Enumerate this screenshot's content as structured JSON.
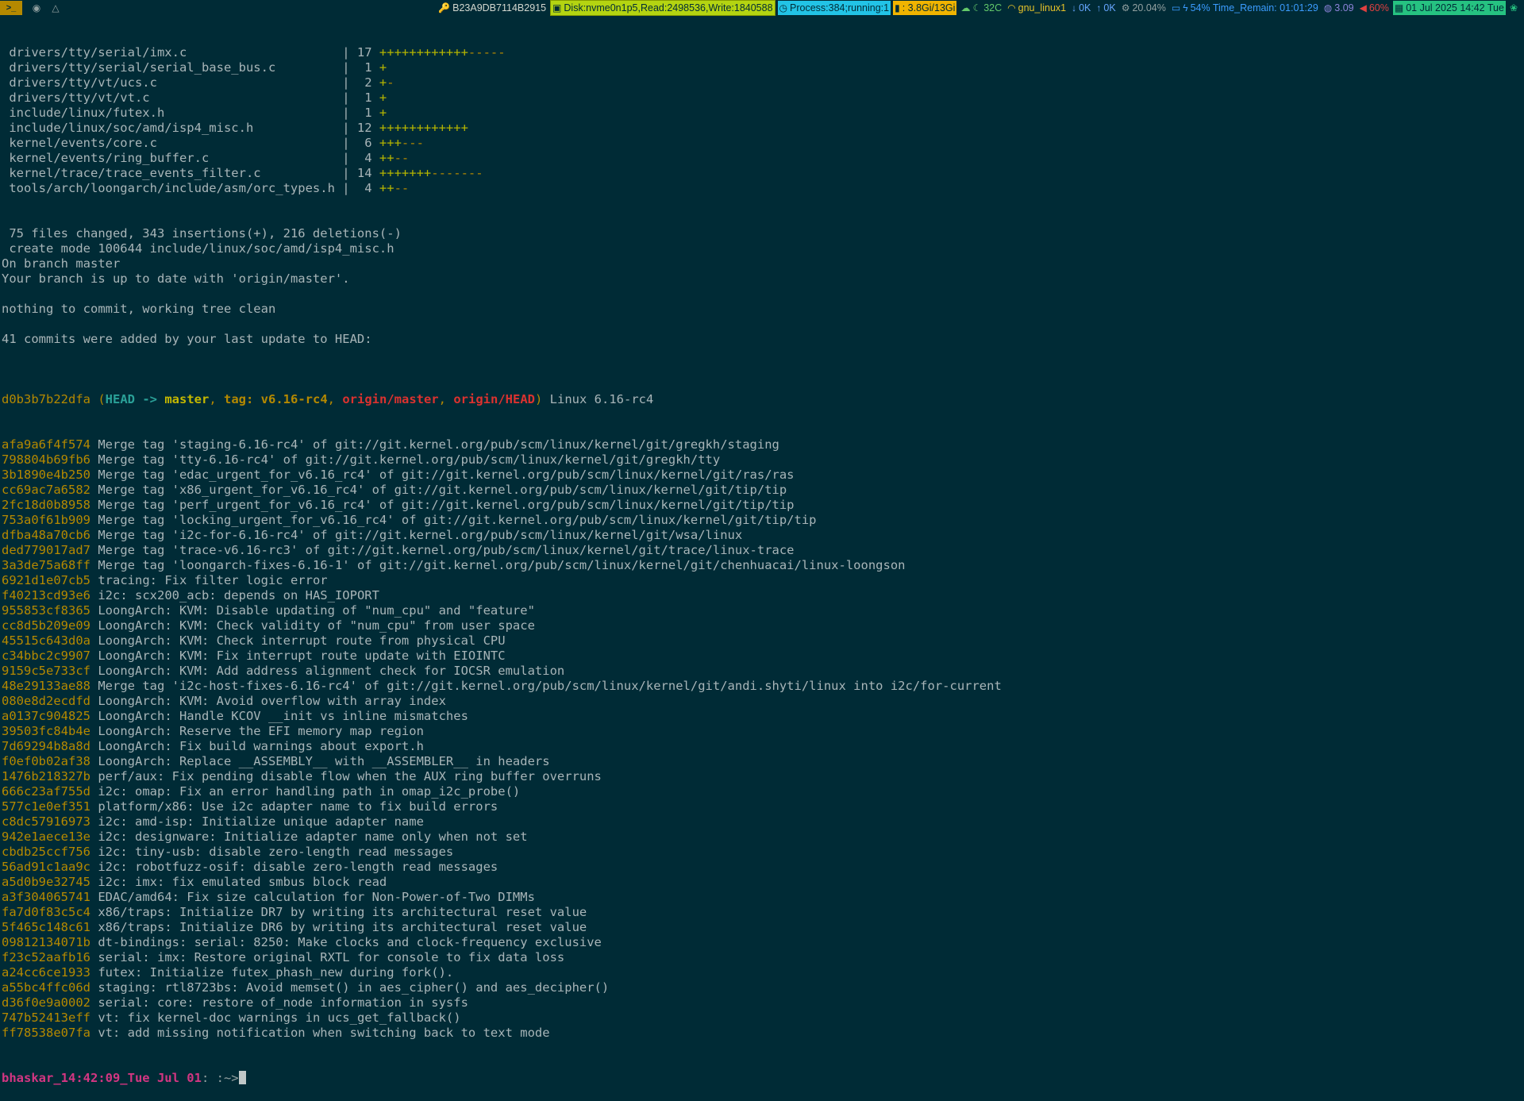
{
  "statusbar": {
    "launcher": {
      "terminal": ">_",
      "btn2": "◉",
      "btn3": "△"
    },
    "key": "B23A9DB7114B2915",
    "disk": "Disk:nvme0n1p5,Read:2498536,Write:1840588",
    "process": "Process:384;running:1",
    "memory": ": 3.8Gi/13Gi",
    "temp": "32C",
    "network": "gnu_linux1",
    "download": "0K",
    "upload": "0K",
    "cpu": "20.04%",
    "battery": "54% Time_Remain: 01:01:29",
    "load": "3.09",
    "volume": "60%",
    "datetime": "01 Jul 2025 14:42 Tue"
  },
  "diffstat": [
    {
      "file": "drivers/tty/serial/imx.c",
      "count": "17",
      "plus": "++++++++++++",
      "minus": "-----"
    },
    {
      "file": "drivers/tty/serial/serial_base_bus.c",
      "count": "1",
      "plus": "+",
      "minus": ""
    },
    {
      "file": "drivers/tty/vt/ucs.c",
      "count": "2",
      "plus": "+",
      "minus": "-"
    },
    {
      "file": "drivers/tty/vt/vt.c",
      "count": "1",
      "plus": "+",
      "minus": ""
    },
    {
      "file": "include/linux/futex.h",
      "count": "1",
      "plus": "+",
      "minus": ""
    },
    {
      "file": "include/linux/soc/amd/isp4_misc.h",
      "count": "12",
      "plus": "++++++++++++",
      "minus": ""
    },
    {
      "file": "kernel/events/core.c",
      "count": "6",
      "plus": "+++",
      "minus": "---"
    },
    {
      "file": "kernel/events/ring_buffer.c",
      "count": "4",
      "plus": "++",
      "minus": "--"
    },
    {
      "file": "kernel/trace/trace_events_filter.c",
      "count": "14",
      "plus": "+++++++",
      "minus": "-------"
    },
    {
      "file": "tools/arch/loongarch/include/asm/orc_types.h",
      "count": "4",
      "plus": "++",
      "minus": "--"
    }
  ],
  "summary": [
    " 75 files changed, 343 insertions(+), 216 deletions(-)",
    " create mode 100644 include/linux/soc/amd/isp4_misc.h",
    "On branch master",
    "Your branch is up to date with 'origin/master'.",
    "",
    "nothing to commit, working tree clean",
    "",
    "41 commits were added by your last update to HEAD:",
    ""
  ],
  "head_commit": {
    "hash": "d0b3b7b22dfa",
    "head": "HEAD",
    "arrow": " -> ",
    "branch": "master",
    "tag": "tag: v6.16-rc4",
    "remote1": "origin/master",
    "remote2": "origin/HEAD",
    "message": "Linux 6.16-rc4"
  },
  "commits": [
    {
      "hash": "afa9a6f4f574",
      "message": "Merge tag 'staging-6.16-rc4' of git://git.kernel.org/pub/scm/linux/kernel/git/gregkh/staging"
    },
    {
      "hash": "798804b69fb6",
      "message": "Merge tag 'tty-6.16-rc4' of git://git.kernel.org/pub/scm/linux/kernel/git/gregkh/tty"
    },
    {
      "hash": "3b1890e4b250",
      "message": "Merge tag 'edac_urgent_for_v6.16_rc4' of git://git.kernel.org/pub/scm/linux/kernel/git/ras/ras"
    },
    {
      "hash": "cc69ac7a6582",
      "message": "Merge tag 'x86_urgent_for_v6.16_rc4' of git://git.kernel.org/pub/scm/linux/kernel/git/tip/tip"
    },
    {
      "hash": "2fc18d0b8958",
      "message": "Merge tag 'perf_urgent_for_v6.16_rc4' of git://git.kernel.org/pub/scm/linux/kernel/git/tip/tip"
    },
    {
      "hash": "753a0f61b909",
      "message": "Merge tag 'locking_urgent_for_v6.16_rc4' of git://git.kernel.org/pub/scm/linux/kernel/git/tip/tip"
    },
    {
      "hash": "dfba48a70cb6",
      "message": "Merge tag 'i2c-for-6.16-rc4' of git://git.kernel.org/pub/scm/linux/kernel/git/wsa/linux"
    },
    {
      "hash": "ded779017ad7",
      "message": "Merge tag 'trace-v6.16-rc3' of git://git.kernel.org/pub/scm/linux/kernel/git/trace/linux-trace"
    },
    {
      "hash": "3a3de75a68ff",
      "message": "Merge tag 'loongarch-fixes-6.16-1' of git://git.kernel.org/pub/scm/linux/kernel/git/chenhuacai/linux-loongson"
    },
    {
      "hash": "6921d1e07cb5",
      "message": "tracing: Fix filter logic error"
    },
    {
      "hash": "f40213cd93e6",
      "message": "i2c: scx200_acb: depends on HAS_IOPORT"
    },
    {
      "hash": "955853cf8365",
      "message": "LoongArch: KVM: Disable updating of \"num_cpu\" and \"feature\""
    },
    {
      "hash": "cc8d5b209e09",
      "message": "LoongArch: KVM: Check validity of \"num_cpu\" from user space"
    },
    {
      "hash": "45515c643d0a",
      "message": "LoongArch: KVM: Check interrupt route from physical CPU"
    },
    {
      "hash": "c34bbc2c9907",
      "message": "LoongArch: KVM: Fix interrupt route update with EIOINTC"
    },
    {
      "hash": "9159c5e733cf",
      "message": "LoongArch: KVM: Add address alignment check for IOCSR emulation"
    },
    {
      "hash": "48e29133ae88",
      "message": "Merge tag 'i2c-host-fixes-6.16-rc4' of git://git.kernel.org/pub/scm/linux/kernel/git/andi.shyti/linux into i2c/for-current"
    },
    {
      "hash": "080e8d2ecdfd",
      "message": "LoongArch: KVM: Avoid overflow with array index"
    },
    {
      "hash": "a0137c904825",
      "message": "LoongArch: Handle KCOV __init vs inline mismatches"
    },
    {
      "hash": "39503fc84b4e",
      "message": "LoongArch: Reserve the EFI memory map region"
    },
    {
      "hash": "7d69294b8a8d",
      "message": "LoongArch: Fix build warnings about export.h"
    },
    {
      "hash": "f0ef0b02af38",
      "message": "LoongArch: Replace __ASSEMBLY__ with __ASSEMBLER__ in headers"
    },
    {
      "hash": "1476b218327b",
      "message": "perf/aux: Fix pending disable flow when the AUX ring buffer overruns"
    },
    {
      "hash": "666c23af755d",
      "message": "i2c: omap: Fix an error handling path in omap_i2c_probe()"
    },
    {
      "hash": "577c1e0ef351",
      "message": "platform/x86: Use i2c adapter name to fix build errors"
    },
    {
      "hash": "c8dc57916973",
      "message": "i2c: amd-isp: Initialize unique adapter name"
    },
    {
      "hash": "942e1aece13e",
      "message": "i2c: designware: Initialize adapter name only when not set"
    },
    {
      "hash": "cbdb25ccf756",
      "message": "i2c: tiny-usb: disable zero-length read messages"
    },
    {
      "hash": "56ad91c1aa9c",
      "message": "i2c: robotfuzz-osif: disable zero-length read messages"
    },
    {
      "hash": "a5d0b9e32745",
      "message": "i2c: imx: fix emulated smbus block read"
    },
    {
      "hash": "a3f304065741",
      "message": "EDAC/amd64: Fix size calculation for Non-Power-of-Two DIMMs"
    },
    {
      "hash": "fa7d0f83c5c4",
      "message": "x86/traps: Initialize DR7 by writing its architectural reset value"
    },
    {
      "hash": "5f465c148c61",
      "message": "x86/traps: Initialize DR6 by writing its architectural reset value"
    },
    {
      "hash": "09812134071b",
      "message": "dt-bindings: serial: 8250: Make clocks and clock-frequency exclusive"
    },
    {
      "hash": "f23c52aafb16",
      "message": "serial: imx: Restore original RXTL for console to fix data loss"
    },
    {
      "hash": "a24cc6ce1933",
      "message": "futex: Initialize futex_phash_new during fork()."
    },
    {
      "hash": "a55bc4ffc06d",
      "message": "staging: rtl8723bs: Avoid memset() in aes_cipher() and aes_decipher()"
    },
    {
      "hash": "d36f0e9a0002",
      "message": "serial: core: restore of_node information in sysfs"
    },
    {
      "hash": "747b52413eff",
      "message": "vt: fix kernel-doc warnings in ucs_get_fallback()"
    },
    {
      "hash": "ff78538e07fa",
      "message": "vt: add missing notification when switching back to text mode"
    }
  ],
  "prompt": {
    "user": "bhaskar_14:42:09_Tue Jul 01",
    "path": ": :~>"
  },
  "colors": {
    "background": "#002b36",
    "hash": "#b58900",
    "head": "#2aa198",
    "remote": "#dc322f",
    "prompt": "#d33682"
  }
}
